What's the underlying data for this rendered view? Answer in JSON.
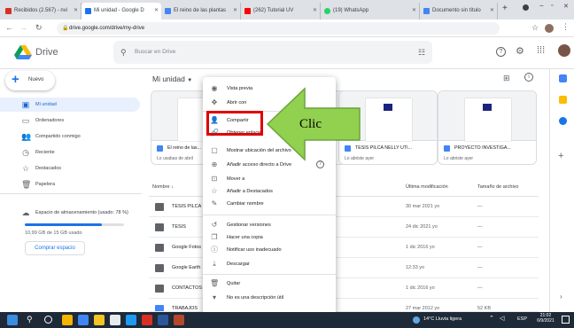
{
  "tabs": [
    {
      "label": "Recibidos (2.567) - nvi",
      "color": "#d93025"
    },
    {
      "label": "Mi unidad - Google D",
      "color": "#1a73e8"
    },
    {
      "label": "El reino de las plantas",
      "color": "#4285f4"
    },
    {
      "label": "(262) Tutorial UV",
      "color": "#ff0000"
    },
    {
      "label": "(19) WhatsApp",
      "color": "#25d366"
    },
    {
      "label": "Documento sin título",
      "color": "#4285f4"
    }
  ],
  "url": "drive.google.com/drive/my-drive",
  "app": {
    "name": "Drive",
    "search_placeholder": "Buscar en Drive"
  },
  "sidebar": {
    "new_label": "Nuevo",
    "items": [
      {
        "label": "Mi unidad",
        "icon": "drive-icon"
      },
      {
        "label": "Ordenadores",
        "icon": "computer-icon"
      },
      {
        "label": "Compartido conmigo",
        "icon": "people-icon"
      },
      {
        "label": "Reciente",
        "icon": "clock-icon"
      },
      {
        "label": "Destacados",
        "icon": "star-icon"
      },
      {
        "label": "Papelera",
        "icon": "trash-icon"
      }
    ],
    "storage_label": "Espacio de almacenamiento (usado: 78 %)",
    "storage_used": "10,99 GB de 15 GB usado",
    "storage_fraction": 0.78,
    "buy_storage": "Comprar espacio"
  },
  "main": {
    "title": "Mi unidad",
    "cards": [
      {
        "name": "El reino de las...",
        "sub": "Lo usabas de abril"
      },
      {
        "name": "",
        "sub": ""
      },
      {
        "name": "TESIS PILCA NELLY UTI...",
        "sub": "Lo abriste ayer"
      },
      {
        "name": "PROYECTO INVESTIGA...",
        "sub": "Lo abriste ayer"
      }
    ],
    "columns": {
      "name": "Nombre",
      "modified": "Última modificación",
      "size": "Tamaño de archivo"
    },
    "rows": [
      {
        "name": "TESIS PILCA",
        "modified": "30 mar 2021 yo",
        "size": "—"
      },
      {
        "name": "TESIS",
        "modified": "24 dic 2021 yo",
        "size": "—"
      },
      {
        "name": "Google Fotos",
        "modified": "1 dic 2016 yo",
        "size": "—"
      },
      {
        "name": "Google Earth",
        "modified": "12:33 yo",
        "size": "—"
      },
      {
        "name": "CONTACTOS",
        "modified": "1 dic 2016 yo",
        "size": "—"
      },
      {
        "name": "TRABAJOS",
        "modified": "27 mar 2012 yo",
        "size": "52 KB"
      }
    ]
  },
  "context_menu": {
    "items": [
      {
        "label": "Vista previa",
        "icon": "eye-icon"
      },
      {
        "label": "Abrir con",
        "icon": "move-icon"
      },
      {
        "label": "Compartir",
        "icon": "share-icon"
      },
      {
        "label": "Obtener enlace",
        "icon": "link-icon"
      },
      {
        "label": "Mostrar ubicación del archivo",
        "icon": "folder-icon"
      },
      {
        "label": "Añadir acceso directo a Drive",
        "icon": "shortcut-icon"
      },
      {
        "label": "Mover a",
        "icon": "move-to-icon"
      },
      {
        "label": "Añadir a Destacados",
        "icon": "star-icon"
      },
      {
        "label": "Cambiar nombre",
        "icon": "pencil-icon"
      },
      {
        "label": "Gestionar versiones",
        "icon": "history-icon"
      },
      {
        "label": "Hacer una copia",
        "icon": "copy-icon"
      },
      {
        "label": "Notificar uso inadecuado",
        "icon": "alert-icon"
      },
      {
        "label": "Descargar",
        "icon": "download-icon"
      },
      {
        "label": "Quitar",
        "icon": "trash-icon"
      },
      {
        "label": "No es una descripción útil",
        "icon": "thumb-down-icon"
      }
    ]
  },
  "annotation": {
    "label": "Clic"
  },
  "taskbar": {
    "weather": "14°C Lluvia ligera",
    "lang": "ESP",
    "time": "21:02",
    "date": "6/9/2021"
  },
  "colors": {
    "accent": "#1a73e8",
    "highlight": "#e8f0fe",
    "arrow_fill": "#92d050",
    "arrow_stroke": "#6aa43a",
    "callout_border": "#e00000"
  }
}
